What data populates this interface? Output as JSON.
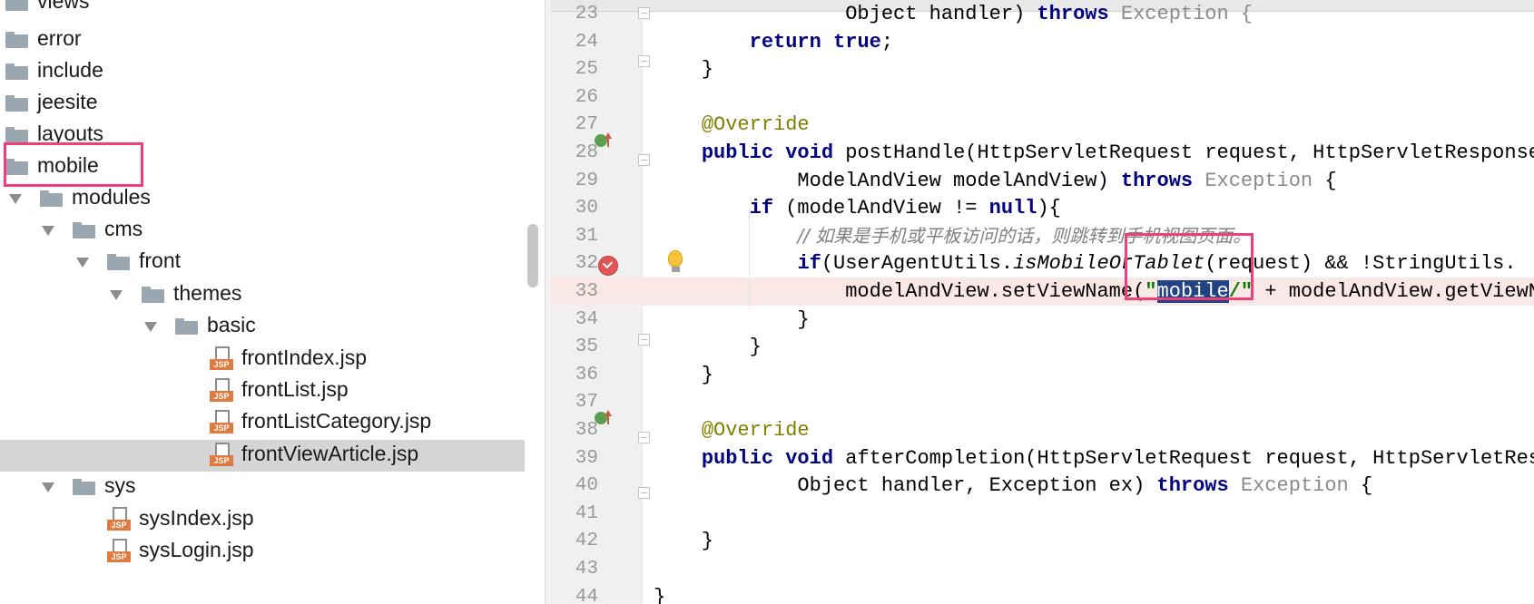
{
  "project_tree": {
    "items": [
      {
        "label": "views",
        "type": "folder",
        "expanded": false
      },
      {
        "label": "error",
        "type": "folder"
      },
      {
        "label": "include",
        "type": "folder"
      },
      {
        "label": "jeesite",
        "type": "folder"
      },
      {
        "label": "layouts",
        "type": "folder"
      },
      {
        "label": "mobile",
        "type": "folder",
        "highlighted": true
      },
      {
        "label": "modules",
        "type": "folder",
        "expanded": true
      },
      {
        "label": "cms",
        "type": "folder",
        "expanded": true
      },
      {
        "label": "front",
        "type": "folder",
        "expanded": true
      },
      {
        "label": "themes",
        "type": "folder",
        "expanded": true
      },
      {
        "label": "basic",
        "type": "folder",
        "expanded": true
      },
      {
        "label": "frontIndex.jsp",
        "type": "jsp"
      },
      {
        "label": "frontList.jsp",
        "type": "jsp"
      },
      {
        "label": "frontListCategory.jsp",
        "type": "jsp"
      },
      {
        "label": "frontViewArticle.jsp",
        "type": "jsp",
        "selected": true
      },
      {
        "label": "sys",
        "type": "folder",
        "expanded": true
      },
      {
        "label": "sysIndex.jsp",
        "type": "jsp"
      },
      {
        "label": "sysLogin.jsp",
        "type": "jsp"
      }
    ],
    "file_badge": "JSP"
  },
  "editor": {
    "lines": [
      {
        "n": "23",
        "parts": [
          {
            "t": "                Object handler) ",
            "c": ""
          },
          {
            "t": "throws",
            "c": "kw"
          },
          {
            "t": " Exception {",
            "c": "grey"
          }
        ]
      },
      {
        "n": "24",
        "parts": [
          {
            "t": "        ",
            "c": ""
          },
          {
            "t": "return true",
            "c": "kw"
          },
          {
            "t": ";",
            "c": ""
          }
        ]
      },
      {
        "n": "25",
        "parts": [
          {
            "t": "    }",
            "c": ""
          }
        ]
      },
      {
        "n": "26",
        "parts": []
      },
      {
        "n": "27",
        "parts": [
          {
            "t": "    ",
            "c": ""
          },
          {
            "t": "@Override",
            "c": "ann"
          }
        ]
      },
      {
        "n": "28",
        "parts": [
          {
            "t": "    ",
            "c": ""
          },
          {
            "t": "public void",
            "c": "kw"
          },
          {
            "t": " postHandle(HttpServletRequest request, HttpServletResponse response,",
            "c": ""
          }
        ]
      },
      {
        "n": "29",
        "parts": [
          {
            "t": "            ModelAndView modelAndView) ",
            "c": ""
          },
          {
            "t": "throws",
            "c": "kw"
          },
          {
            "t": " ",
            "c": ""
          },
          {
            "t": "Exception",
            "c": "grey"
          },
          {
            "t": " {",
            "c": ""
          }
        ]
      },
      {
        "n": "30",
        "parts": [
          {
            "t": "        ",
            "c": ""
          },
          {
            "t": "if",
            "c": "kw"
          },
          {
            "t": " (modelAndView != ",
            "c": ""
          },
          {
            "t": "null",
            "c": "kw"
          },
          {
            "t": "){",
            "c": ""
          }
        ]
      },
      {
        "n": "31",
        "parts": [
          {
            "t": "            ",
            "c": ""
          },
          {
            "t": "// 如果是手机或平板访问的话，则跳转到手机视图页面。",
            "c": "cmt"
          }
        ]
      },
      {
        "n": "32",
        "parts": [
          {
            "t": "            ",
            "c": ""
          },
          {
            "t": "if",
            "c": "kw"
          },
          {
            "t": "(UserAgentUtils.",
            "c": ""
          },
          {
            "t": "isMobileOrTablet",
            "c": "it"
          },
          {
            "t": "(request) && !StringUtils.",
            "c": ""
          }
        ]
      },
      {
        "n": "33",
        "parts": [
          {
            "t": "                modelAndView.setViewName(",
            "c": ""
          },
          {
            "t": "\"",
            "c": "str"
          },
          {
            "t": "mobile",
            "c": "sel"
          },
          {
            "t": "/\"",
            "c": "str"
          },
          {
            "t": " + modelAndView.getViewName());",
            "c": ""
          }
        ],
        "current": true
      },
      {
        "n": "34",
        "parts": [
          {
            "t": "            }",
            "c": ""
          }
        ]
      },
      {
        "n": "35",
        "parts": [
          {
            "t": "        }",
            "c": ""
          }
        ]
      },
      {
        "n": "36",
        "parts": [
          {
            "t": "    }",
            "c": ""
          }
        ]
      },
      {
        "n": "37",
        "parts": []
      },
      {
        "n": "38",
        "parts": [
          {
            "t": "    ",
            "c": ""
          },
          {
            "t": "@Override",
            "c": "ann"
          }
        ]
      },
      {
        "n": "39",
        "parts": [
          {
            "t": "    ",
            "c": ""
          },
          {
            "t": "public void",
            "c": "kw"
          },
          {
            "t": " afterCompletion(HttpServletRequest request, HttpServletResponse response,",
            "c": ""
          }
        ]
      },
      {
        "n": "40",
        "parts": [
          {
            "t": "            Object handler, Exception ex) ",
            "c": ""
          },
          {
            "t": "throws",
            "c": "kw"
          },
          {
            "t": " ",
            "c": ""
          },
          {
            "t": "Exception",
            "c": "grey"
          },
          {
            "t": " {",
            "c": ""
          }
        ]
      },
      {
        "n": "41",
        "parts": []
      },
      {
        "n": "42",
        "parts": [
          {
            "t": "    }",
            "c": ""
          }
        ]
      },
      {
        "n": "43",
        "parts": []
      },
      {
        "n": "44",
        "parts": [
          {
            "t": "}",
            "c": ""
          }
        ]
      }
    ]
  },
  "colors": {
    "highlight_box": "#ef3f7b",
    "keyword": "#000080",
    "annotation": "#808000",
    "string": "#008000",
    "selection": "#214283",
    "current_line": "#fae8e6"
  }
}
